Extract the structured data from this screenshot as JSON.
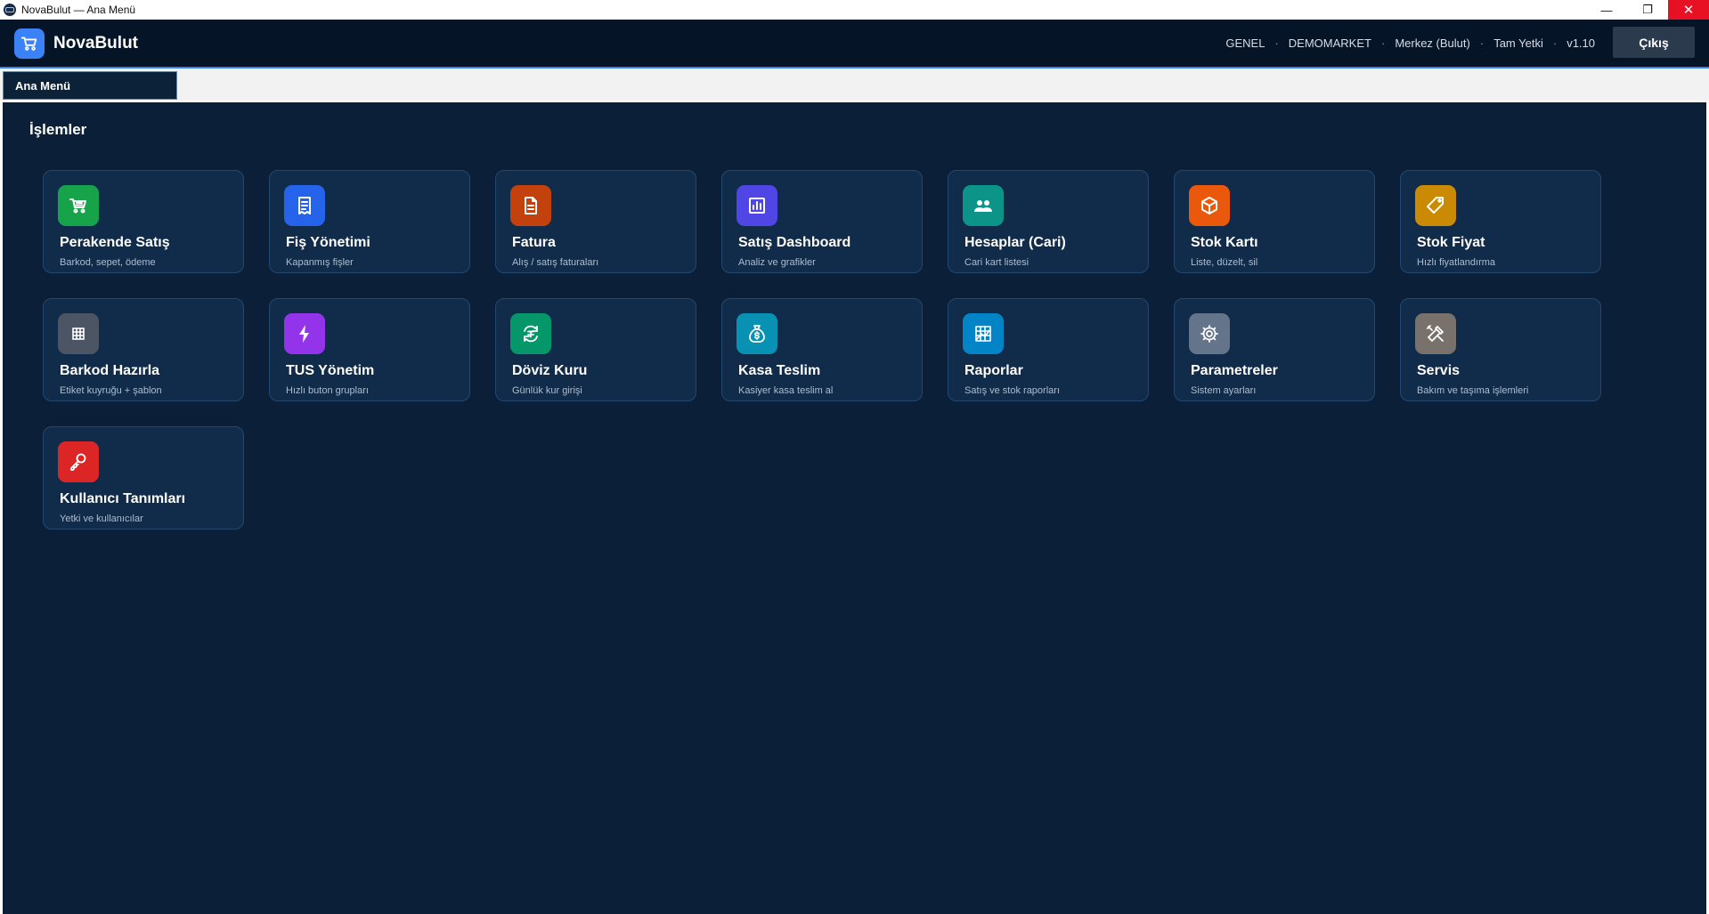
{
  "window": {
    "title": "NovaBulut — Ana Menü",
    "controls": {
      "minimize": "—",
      "maximize": "❐",
      "close": "✕"
    }
  },
  "header": {
    "brand": "NovaBulut",
    "info": [
      "GENEL",
      "DEMOMARKET",
      "Merkez (Bulut)",
      "Tam Yetki",
      "v1.10"
    ],
    "separator": "·",
    "logout_label": "Çıkış",
    "accent_color": "#3b82f6"
  },
  "tabs": [
    {
      "label": "Ana Menü",
      "active": true
    }
  ],
  "main": {
    "section_title": "İşlemler",
    "cards": [
      {
        "title": "Perakende Satış",
        "subtitle": "Barkod, sepet, ödeme",
        "icon": "cart-icon",
        "color": "#16a34a"
      },
      {
        "title": "Fiş Yönetimi",
        "subtitle": "Kapanmış fişler",
        "icon": "receipt-icon",
        "color": "#2563eb"
      },
      {
        "title": "Fatura",
        "subtitle": "Alış / satış faturaları",
        "icon": "document-icon",
        "color": "#c2410c"
      },
      {
        "title": "Satış Dashboard",
        "subtitle": "Analiz ve grafikler",
        "icon": "bar-chart-icon",
        "color": "#4f46e5"
      },
      {
        "title": "Hesaplar (Cari)",
        "subtitle": "Cari kart listesi",
        "icon": "users-icon",
        "color": "#0d9488"
      },
      {
        "title": "Stok Kartı",
        "subtitle": "Liste, düzelt, sil",
        "icon": "box-icon",
        "color": "#ea580c"
      },
      {
        "title": "Stok Fiyat",
        "subtitle": "Hızlı fiyatlandırma",
        "icon": "price-tag-icon",
        "color": "#ca8a04"
      },
      {
        "title": "Barkod Hazırla",
        "subtitle": "Etiket kuyruğu + şablon",
        "icon": "grid-icon",
        "color": "#4b5563"
      },
      {
        "title": "TUS Yönetim",
        "subtitle": "Hızlı buton grupları",
        "icon": "lightning-icon",
        "color": "#9333ea"
      },
      {
        "title": "Döviz Kuru",
        "subtitle": "Günlük kur girişi",
        "icon": "currency-exchange-icon",
        "color": "#059669"
      },
      {
        "title": "Kasa Teslim",
        "subtitle": "Kasiyer kasa teslim al",
        "icon": "money-bag-icon",
        "color": "#0891b2"
      },
      {
        "title": "Raporlar",
        "subtitle": "Satış ve stok raporları",
        "icon": "report-chart-icon",
        "color": "#0284c7"
      },
      {
        "title": "Parametreler",
        "subtitle": "Sistem ayarları",
        "icon": "gear-icon",
        "color": "#64748b"
      },
      {
        "title": "Servis",
        "subtitle": "Bakım ve taşıma işlemleri",
        "icon": "tools-icon",
        "color": "#78716c"
      },
      {
        "title": "Kullanıcı Tanımları",
        "subtitle": "Yetki ve kullanıcılar",
        "icon": "key-icon",
        "color": "#dc2626"
      }
    ]
  }
}
